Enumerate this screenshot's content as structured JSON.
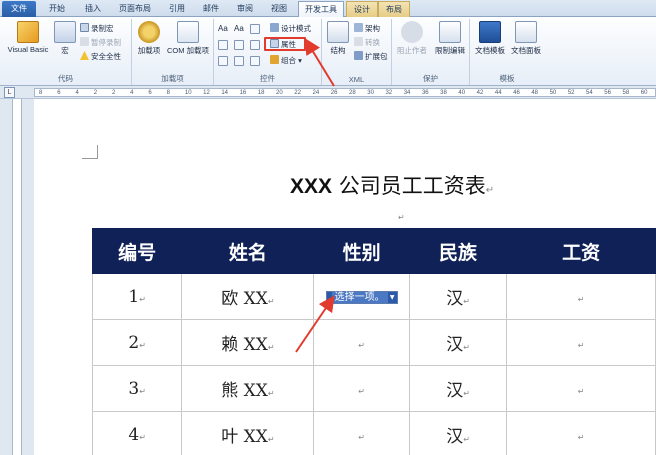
{
  "tabs": [
    "文件",
    "开始",
    "插入",
    "页面布局",
    "引用",
    "邮件",
    "审阅",
    "视图",
    "开发工具",
    "设计",
    "布局"
  ],
  "ribbon": {
    "code": {
      "label": "代码",
      "visual_basic": "Visual Basic",
      "macro": "宏",
      "record_macro": "录制宏",
      "pause_recording": "暂停录制",
      "macro_security": "安全全性"
    },
    "addins": {
      "label": "加载项",
      "addins_btn": "加载项",
      "com_addins": "COM 加载项"
    },
    "controls": {
      "label": "控件",
      "design_mode": "设计模式",
      "properties": "属性",
      "group": "组合"
    },
    "xml": {
      "label": "XML",
      "structure": "结构",
      "schema": "架构",
      "transform": "转换",
      "expansion_pack": "扩展包"
    },
    "protect": {
      "label": "保护",
      "block_authors": "阻止作者",
      "restrict_editing": "限制编辑"
    },
    "templates": {
      "label": "模板",
      "document_template": "文档模板",
      "document_panel": "文档面板"
    }
  },
  "ruler": {
    "corner": "L",
    "numbers": [
      "8",
      "6",
      "4",
      "2",
      "2",
      "4",
      "6",
      "8",
      "10",
      "12",
      "14",
      "16",
      "18",
      "20",
      "22",
      "24",
      "26",
      "28",
      "30",
      "32",
      "34",
      "36",
      "38",
      "40",
      "42",
      "44",
      "46",
      "48",
      "50",
      "52",
      "54",
      "56",
      "58",
      "60"
    ]
  },
  "document": {
    "title_bold": "XXX",
    "title_rest": " 公司员工工资表",
    "pilcrow": "↵",
    "table": {
      "headers": [
        "编号",
        "姓名",
        "性别",
        "民族",
        "工资"
      ],
      "rows": [
        {
          "id": "1",
          "name": "欧 XX",
          "gender": "",
          "ethnic": "汉",
          "salary": ""
        },
        {
          "id": "2",
          "name": "赖 XX",
          "gender": "",
          "ethnic": "汉",
          "salary": ""
        },
        {
          "id": "3",
          "name": "熊 XX",
          "gender": "",
          "ethnic": "汉",
          "salary": ""
        },
        {
          "id": "4",
          "name": "叶 XX",
          "gender": "",
          "ethnic": "汉",
          "salary": ""
        }
      ]
    },
    "content_control": {
      "placeholder": "选择一项。"
    }
  },
  "colors": {
    "header_bg": "#0f2156",
    "highlight": "#e23b2e",
    "file_tab": "#2a5ea5"
  }
}
